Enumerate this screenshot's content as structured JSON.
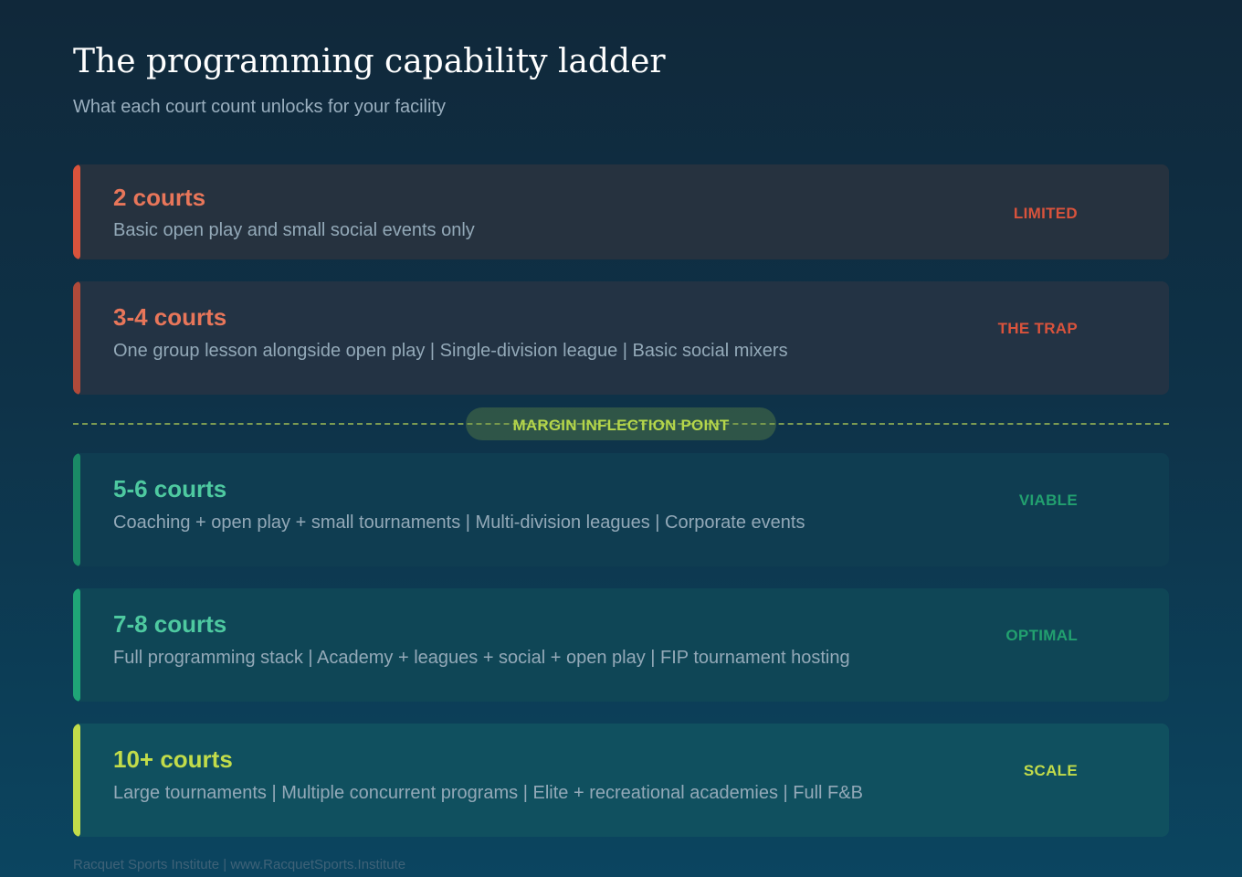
{
  "header": {
    "title": "The programming capability ladder",
    "subtitle": "What each court count unlocks for your facility"
  },
  "tiers": [
    {
      "heading": "2 courts",
      "description": "Basic open play and small social events only",
      "status": "LIMITED",
      "accent_color": "#d9533c",
      "heading_color": "#e8765a",
      "status_color": "#d9533c"
    },
    {
      "heading": "3-4 courts",
      "description": "One group lesson alongside open play | Single-division league | Basic social mixers",
      "status": "THE TRAP",
      "accent_color": "#b04a3a",
      "heading_color": "#e8765a",
      "status_color": "#d9533c"
    },
    {
      "heading": "5-6 courts",
      "description": "Coaching + open play + small tournaments | Multi-division leagues | Corporate events",
      "status": "VIABLE",
      "accent_color": "#1a8a66",
      "heading_color": "#4ec9a0",
      "status_color": "#22a06f"
    },
    {
      "heading": "7-8 courts",
      "description": "Full programming stack | Academy + leagues + social + open play | FIP tournament hosting",
      "status": "OPTIMAL",
      "accent_color": "#1fa677",
      "heading_color": "#4ec9a0",
      "status_color": "#22a06f"
    },
    {
      "heading": "10+ courts",
      "description": "Large tournaments | Multiple concurrent programs | Elite + recreational academies | Full F&B",
      "status": "SCALE",
      "accent_color": "#c2dc4a",
      "heading_color": "#c2dc4a",
      "status_color": "#c2dc4a"
    }
  ],
  "divider": {
    "label": "MARGIN INFLECTION POINT",
    "color": "#b5d64a"
  },
  "footer": {
    "text": "Racquet Sports Institute | www.RacquetSports.Institute"
  }
}
